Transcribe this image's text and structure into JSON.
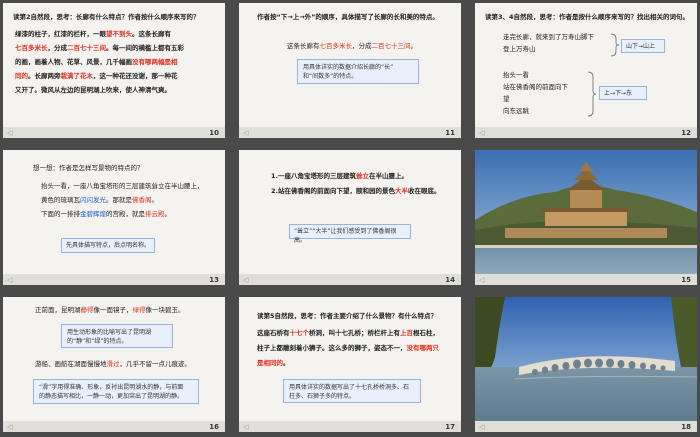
{
  "slides": [
    {
      "number": "10",
      "title": "读第2自然段，思考：长廊有什么特点？作者按什么顺序来写的？",
      "lines": [
        [
          "绿漆的柱子，红漆的栏杆，一眼",
          "望不到头",
          "。这条长廊有"
        ],
        [
          "七百多米长",
          "，分成",
          "二百七十三间",
          "。每一间的横槛上都有五彩"
        ],
        [
          "的画，画着人物、花草、风景，几千幅画",
          "没有哪两幅是相"
        ],
        [
          "同的",
          "。长廊两旁",
          "栽满了花木",
          "，这一种花还没谢，那一种花"
        ],
        [
          "又开了。微风从左边的昆明湖上吹来，使人神清气爽。"
        ]
      ]
    },
    {
      "number": "11",
      "title": "作者按“下→上→外”的顺序，具体描写了长廊的长和美的特点。",
      "line1": [
        "这条长廊有",
        "七百多米长",
        "，分成",
        "二百七十三间",
        "。"
      ],
      "box_lines": [
        "用具体详实的数据介绍长廊的“长”",
        "和“间数多”的特点。"
      ]
    },
    {
      "number": "12",
      "title": "读第3、4自然段，思考：作者是按什么顺序来写的？找出相关的词句。",
      "group1": [
        "走完长廊，就来到了万寿山脚下",
        "登上万寿山"
      ],
      "answer1": "山下→山上",
      "group2": [
        "抬头一看",
        "站在佛香阁的前面向下",
        "望",
        "向东远眺"
      ],
      "answer2": "上→下→东"
    },
    {
      "number": "13",
      "title": "想一想：作者是怎样写景物的特点的？",
      "lines": [
        [
          "抬头一看，一座八角宝塔形的三层建筑耸立在半山腰上，"
        ],
        [
          "黄色的琉璃瓦",
          "闪闪发光",
          "。那就是",
          "佛香阁",
          "。"
        ],
        [
          "下面的一排排",
          "金碧辉煌",
          "的宫殿，就是",
          "排云殿",
          "。"
        ]
      ],
      "box_lines": [
        "先具体描写特点，后点明名称。"
      ]
    },
    {
      "number": "14",
      "lines": [
        [
          "1.一座八角宝塔形的三层建筑",
          "耸立",
          "在半山腰上。"
        ],
        [
          "2.站在佛香阁的前面向下望，颐和园的景色",
          "大半",
          "收在眼底。"
        ]
      ],
      "box_lines": [
        "“耸立”“大半”让我们感受到了佛香阁很高。"
      ]
    },
    {
      "number": "15"
    },
    {
      "number": "16",
      "lines": [
        [
          "正前面，昆明湖",
          "静得",
          "像一面镜子，",
          "绿得",
          "像一块碧玉。"
        ]
      ],
      "box1_lines": [
        "用生动形象的比喻写出了昆明湖",
        "的“静”和“绿”的特点。"
      ],
      "line2": [
        "游船、画舫在湖面慢慢地",
        "滑过",
        "，几乎不留一点儿痕迹。"
      ],
      "box2_lines": [
        "“滑”字用得准确、形象，反衬出昆明湖水的静，与前面",
        "的静态描写相比，一静一动，更加突出了昆明湖的静。"
      ]
    },
    {
      "number": "17",
      "title": "读第5自然段，思考：作者主要介绍了什么景物？有什么特点？",
      "lines": [
        [
          "这座石桥有",
          "十七个",
          "桥洞，叫十七孔桥；桥栏杆上有",
          "上百",
          "根石柱，"
        ],
        [
          "柱子上都雕刻着小狮子。这么多的狮子，姿态不一，",
          "没有哪两只"
        ],
        [
          "是相同的",
          "。"
        ]
      ],
      "box_lines": [
        "用具体详实的数据写出了十七孔桥桥洞多、石",
        "柱多、石狮子多的特点。"
      ]
    },
    {
      "number": "18"
    }
  ],
  "colors": {
    "red": "#e03020",
    "blue": "#1e5fc8",
    "slide_bg": "#f4f3f0",
    "page_bg": "#4a4a4a"
  }
}
